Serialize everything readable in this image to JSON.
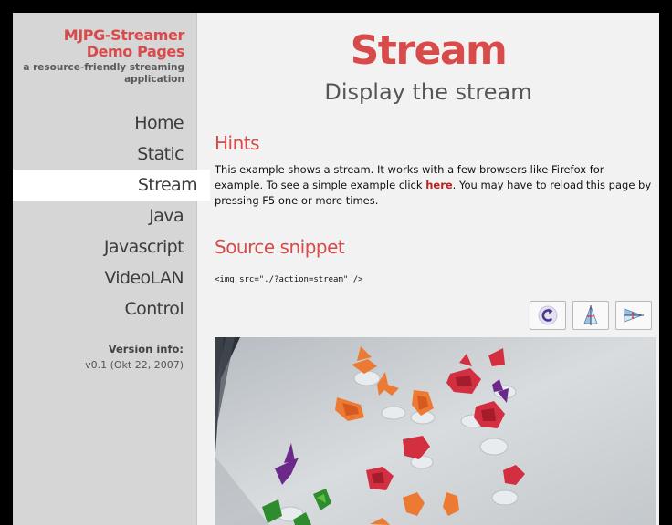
{
  "sidebar": {
    "brand_title_line1": "MJPG-Streamer",
    "brand_title_line2": "Demo Pages",
    "brand_sub_line1": "a resource-friendly streaming",
    "brand_sub_line2": "application",
    "nav": [
      "Home",
      "Static",
      "Stream",
      "Java",
      "Javascript",
      "VideoLAN",
      "Control"
    ],
    "active_nav": "Stream",
    "version_label": "Version info:",
    "version_value": "v0.1 (Okt 22, 2007)"
  },
  "main": {
    "title": "Stream",
    "subtitle": "Display the stream",
    "hints_heading": "Hints",
    "hints_text_1": "This example shows a stream. It works with a few browsers like Firefox for example. To see a simple example click ",
    "hints_link": "here",
    "hints_text_2": ". You may have to reload this page by pressing F5 one or more times.",
    "source_heading": "Source snippet",
    "source_code": "<img src=\"./?action=stream\" />"
  },
  "toolbar": {
    "icons": [
      "rotate-icon",
      "flip-vertical-icon",
      "flip-horizontal-icon"
    ]
  },
  "colors": {
    "accent": "#d84b4b",
    "sidebar_bg": "#d6d6d6",
    "page_bg": "#f2f2f2"
  }
}
